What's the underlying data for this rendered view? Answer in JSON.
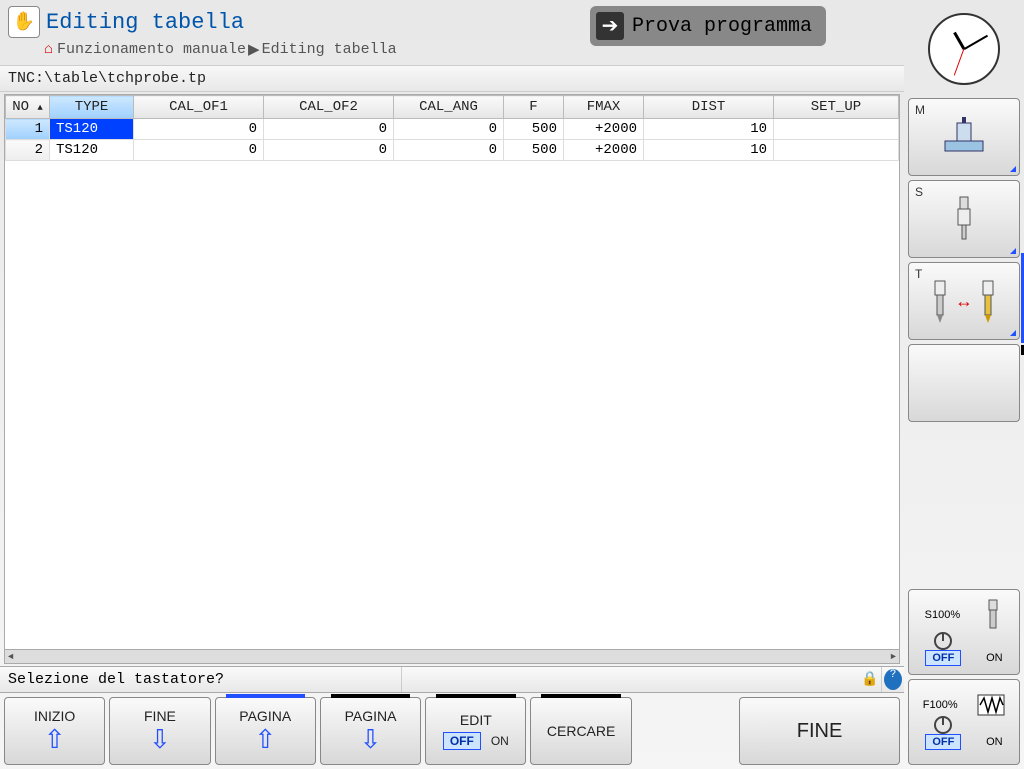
{
  "header": {
    "title": "Editing tabella",
    "breadcrumb_home": "⌂",
    "breadcrumb_1": "Funzionamento manuale",
    "breadcrumb_2": "Editing tabella",
    "secondary_mode": "Prova programma"
  },
  "file_path": "TNC:\\table\\tchprobe.tp",
  "table": {
    "columns": [
      "NO",
      "TYPE",
      "CAL_OF1",
      "CAL_OF2",
      "CAL_ANG",
      "F",
      "FMAX",
      "DIST",
      "SET_UP"
    ],
    "rows": [
      {
        "no": "1",
        "type": "TS120",
        "cal_of1": "0",
        "cal_of2": "0",
        "cal_ang": "0",
        "f": "500",
        "fmax": "+2000",
        "dist": "10",
        "set_up": ""
      },
      {
        "no": "2",
        "type": "TS120",
        "cal_of1": "0",
        "cal_of2": "0",
        "cal_ang": "0",
        "f": "500",
        "fmax": "+2000",
        "dist": "10",
        "set_up": ""
      }
    ]
  },
  "prompt": "Selezione del tastatore?",
  "softkeys": {
    "k1": "INIZIO",
    "k2": "FINE",
    "k3": "PAGINA",
    "k4": "PAGINA",
    "k5": "EDIT",
    "k5_off": "OFF",
    "k5_on": "ON",
    "k6": "CERCARE",
    "end": "FINE"
  },
  "sidebar": {
    "m": "M",
    "s": "S",
    "t": "T",
    "ov_s": "S100%",
    "ov_f": "F100%",
    "off": "OFF",
    "on": "ON"
  }
}
